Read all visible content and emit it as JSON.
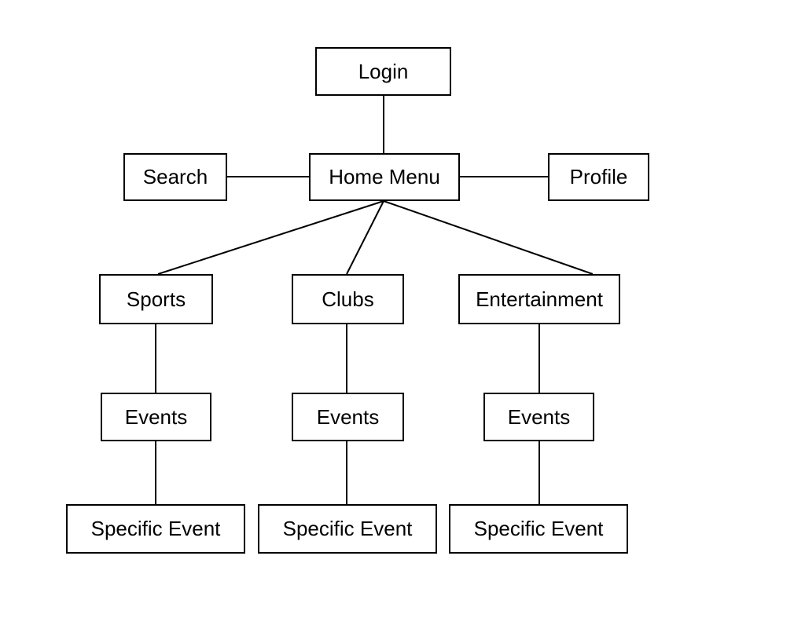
{
  "nodes": {
    "login": "Login",
    "search": "Search",
    "home_menu": "Home Menu",
    "profile": "Profile",
    "sports": "Sports",
    "clubs": "Clubs",
    "entertainment": "Entertainment",
    "events_sports": "Events",
    "events_clubs": "Events",
    "events_entertainment": "Events",
    "specific_sports": "Specific Event",
    "specific_clubs": "Specific Event",
    "specific_entertainment": "Specific Event"
  }
}
